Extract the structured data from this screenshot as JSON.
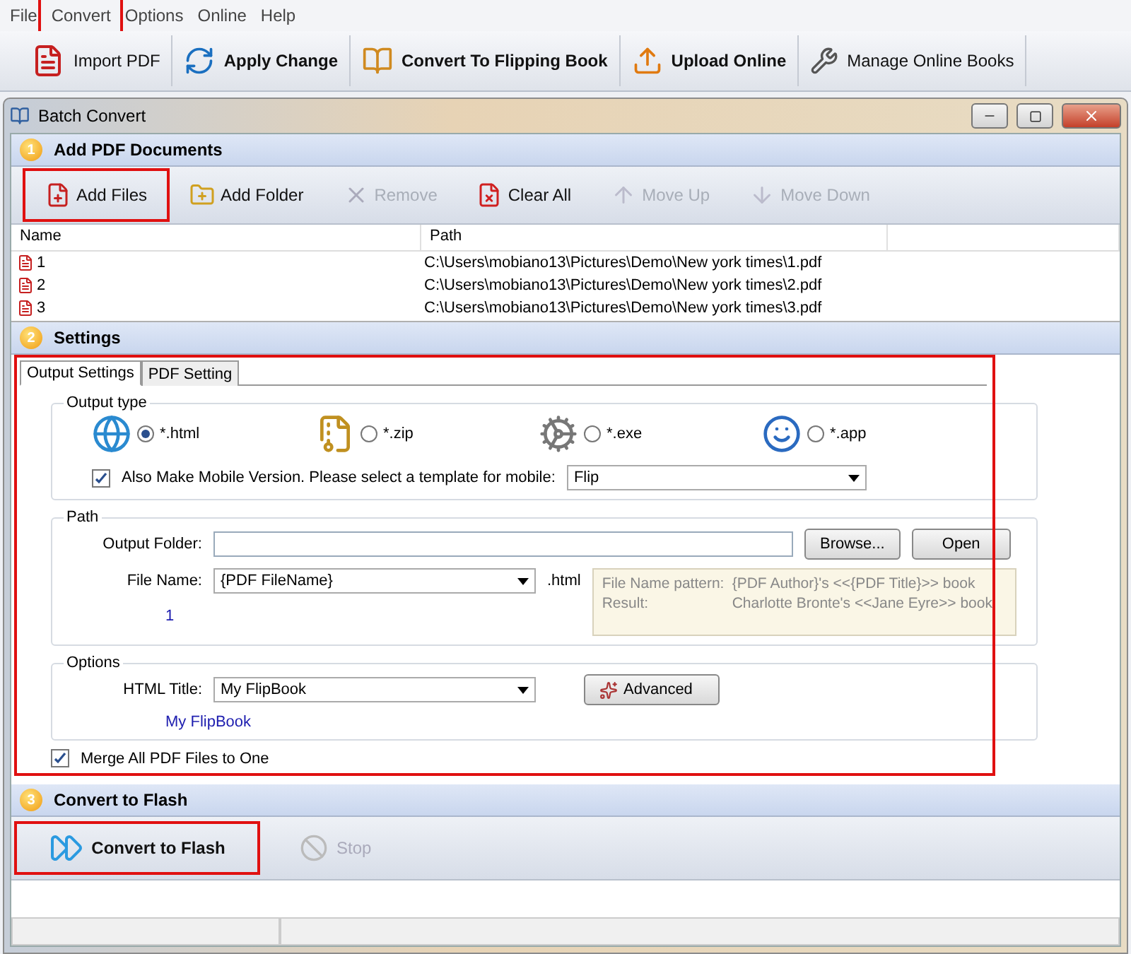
{
  "menu": [
    {
      "label": "File",
      "highlighted": false
    },
    {
      "label": "Convert",
      "highlighted": true
    },
    {
      "label": "Options",
      "highlighted": false
    },
    {
      "label": "Online",
      "highlighted": false
    },
    {
      "label": "Help",
      "highlighted": false
    }
  ],
  "toolbar": [
    {
      "label": "Import PDF",
      "kind": "pdf",
      "bold": false
    },
    {
      "label": "Apply Change",
      "kind": "refresh",
      "bold": true
    },
    {
      "label": "Convert To Flipping Book",
      "kind": "book",
      "bold": true
    },
    {
      "label": "Upload Online",
      "kind": "upload",
      "bold": true
    },
    {
      "label": "Manage Online Books",
      "kind": "wrench",
      "bold": false
    }
  ],
  "window": {
    "title": "Batch Convert"
  },
  "section_1": {
    "number": "1",
    "title": "Add PDF Documents"
  },
  "file_toolbar": [
    {
      "label": "Add Files",
      "kind": "addfile",
      "disabled": false,
      "highlighted": true
    },
    {
      "label": "Add Folder",
      "kind": "addfolder",
      "disabled": false,
      "highlighted": false
    },
    {
      "label": "Remove",
      "kind": "remove",
      "disabled": true,
      "highlighted": false
    },
    {
      "label": "Clear All",
      "kind": "clear",
      "disabled": false,
      "highlighted": false
    },
    {
      "label": "Move Up",
      "kind": "up",
      "disabled": true,
      "highlighted": false
    },
    {
      "label": "Move Down",
      "kind": "down",
      "disabled": true,
      "highlighted": false
    }
  ],
  "file_table": {
    "columns": [
      "Name",
      "Path"
    ],
    "rows": [
      {
        "name": "1",
        "path": "C:\\Users\\mobiano13\\Pictures\\Demo\\New york times\\1.pdf"
      },
      {
        "name": "2",
        "path": "C:\\Users\\mobiano13\\Pictures\\Demo\\New york times\\2.pdf"
      },
      {
        "name": "3",
        "path": "C:\\Users\\mobiano13\\Pictures\\Demo\\New york times\\3.pdf"
      }
    ]
  },
  "section_2": {
    "number": "2",
    "title": "Settings",
    "highlighted": true
  },
  "tabs": [
    {
      "label": "Output Settings",
      "selected": true
    },
    {
      "label": "PDF Setting",
      "selected": false
    }
  ],
  "output_type": {
    "legend": "Output type",
    "options": [
      {
        "label": "*.html",
        "kind": "html",
        "selected": true
      },
      {
        "label": "*.zip",
        "kind": "zip",
        "selected": false
      },
      {
        "label": "*.exe",
        "kind": "exe",
        "selected": false
      },
      {
        "label": "*.app",
        "kind": "app",
        "selected": false
      }
    ],
    "mobile": {
      "label": "Also Make Mobile Version. Please select a template for mobile:",
      "checked": true,
      "value": "Flip"
    }
  },
  "path": {
    "legend": "Path",
    "output_folder_label": "Output Folder:",
    "browse": "Browse...",
    "open": "Open",
    "file_name_label": "File Name:",
    "file_name_value": "{PDF FileName}",
    "extension": ".html",
    "preview": "1",
    "pattern": [
      {
        "label": "File Name pattern:",
        "value": "{PDF Author}'s <<{PDF Title}>> book"
      },
      {
        "label": "Result:",
        "value": "Charlotte Bronte's <<Jane Eyre>> book"
      }
    ]
  },
  "options": {
    "legend": "Options",
    "html_title_label": "HTML Title:",
    "html_title_value": "My FlipBook",
    "advanced": "Advanced",
    "preview": "My FlipBook"
  },
  "merge": {
    "label": "Merge All PDF Files to One",
    "checked": true
  },
  "section_3": {
    "number": "3",
    "title": "Convert to Flash"
  },
  "actions": [
    {
      "label": "Convert to Flash",
      "kind": "convert",
      "disabled": false,
      "highlighted": true
    },
    {
      "label": "Stop",
      "kind": "stop",
      "disabled": true,
      "highlighted": false
    }
  ]
}
